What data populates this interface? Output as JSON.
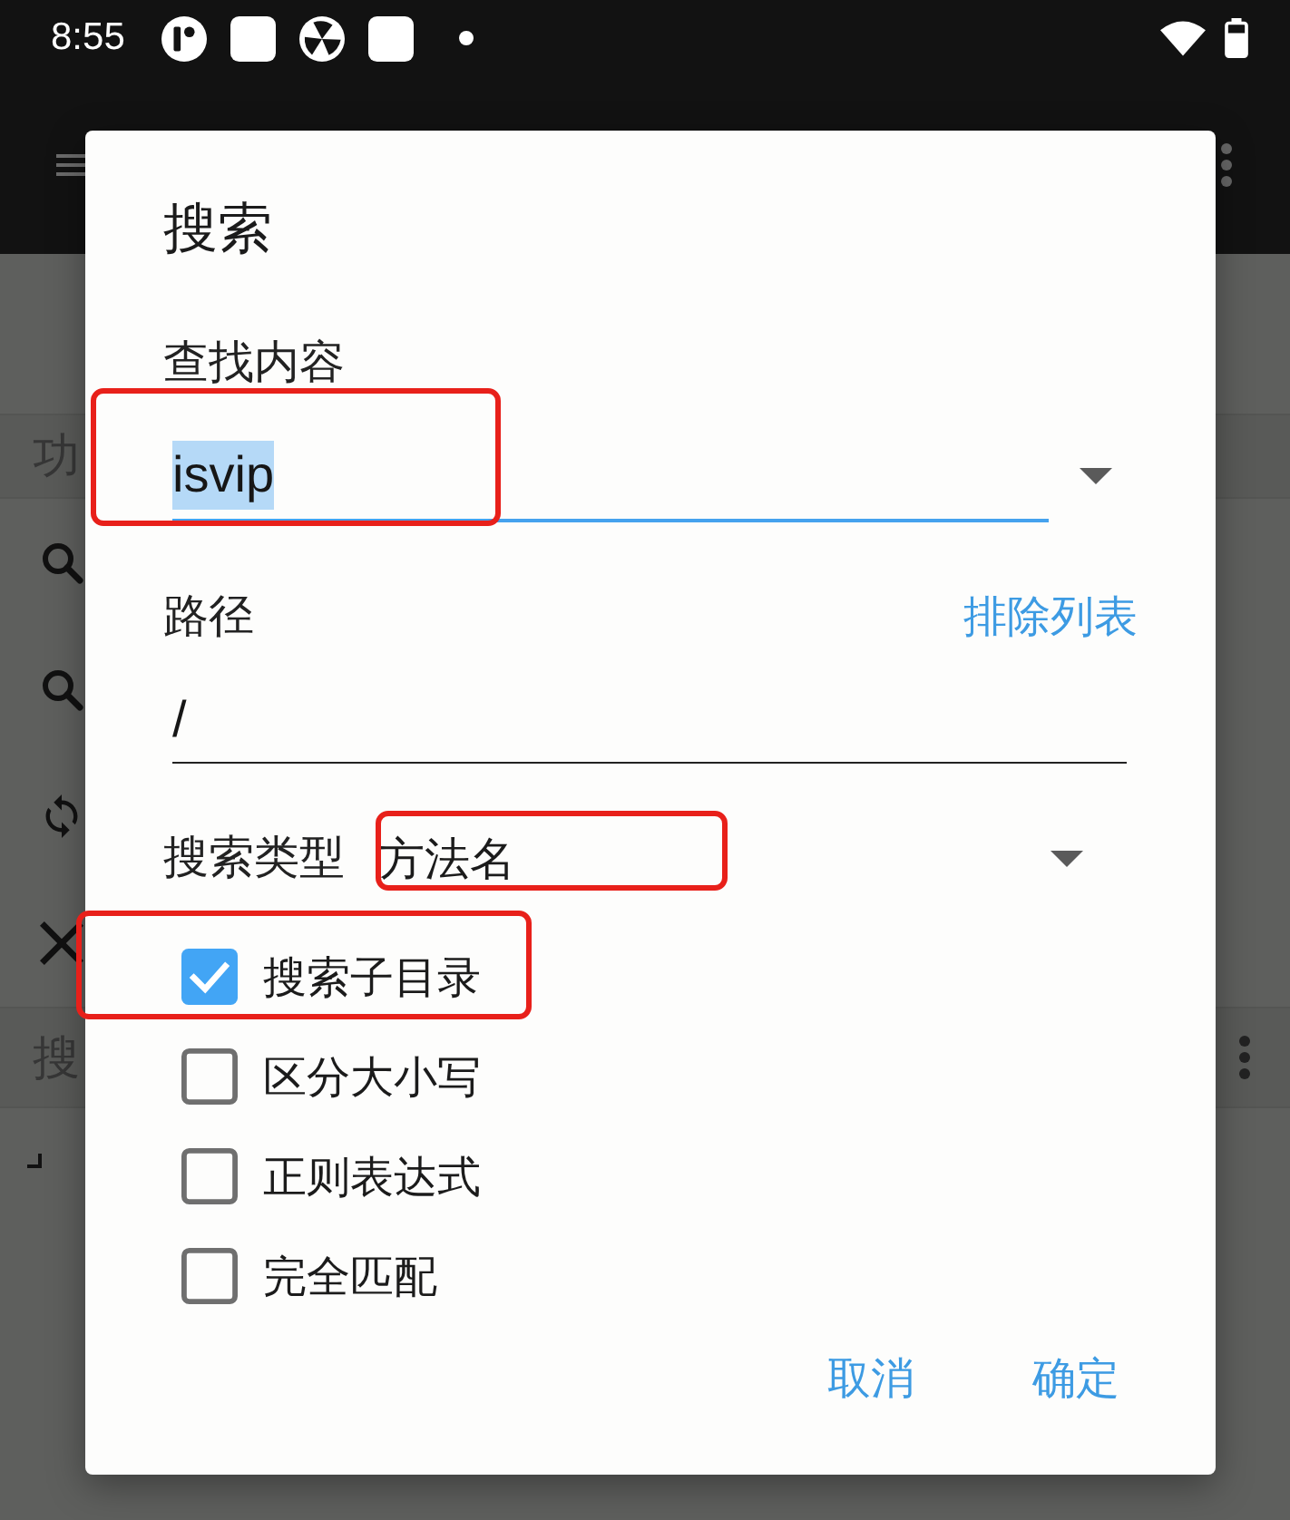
{
  "status_bar": {
    "time": "8:55"
  },
  "background_page": {
    "section_headers": [
      "功",
      "搜"
    ]
  },
  "dialog": {
    "title": "搜索",
    "query": {
      "label": "查找内容",
      "value": "isvip",
      "value_selected": true,
      "highlighted": true
    },
    "path": {
      "label": "路径",
      "link": "排除列表",
      "value": "/"
    },
    "search_type": {
      "label": "搜索类型",
      "value": "方法名",
      "highlighted": true
    },
    "options": [
      {
        "label": "搜索子目录",
        "checked": true,
        "highlighted": true
      },
      {
        "label": "区分大小写",
        "checked": false,
        "highlighted": false
      },
      {
        "label": "正则表达式",
        "checked": false,
        "highlighted": false
      },
      {
        "label": "完全匹配",
        "checked": false,
        "highlighted": false
      }
    ],
    "buttons": [
      "取消",
      "确定"
    ]
  }
}
